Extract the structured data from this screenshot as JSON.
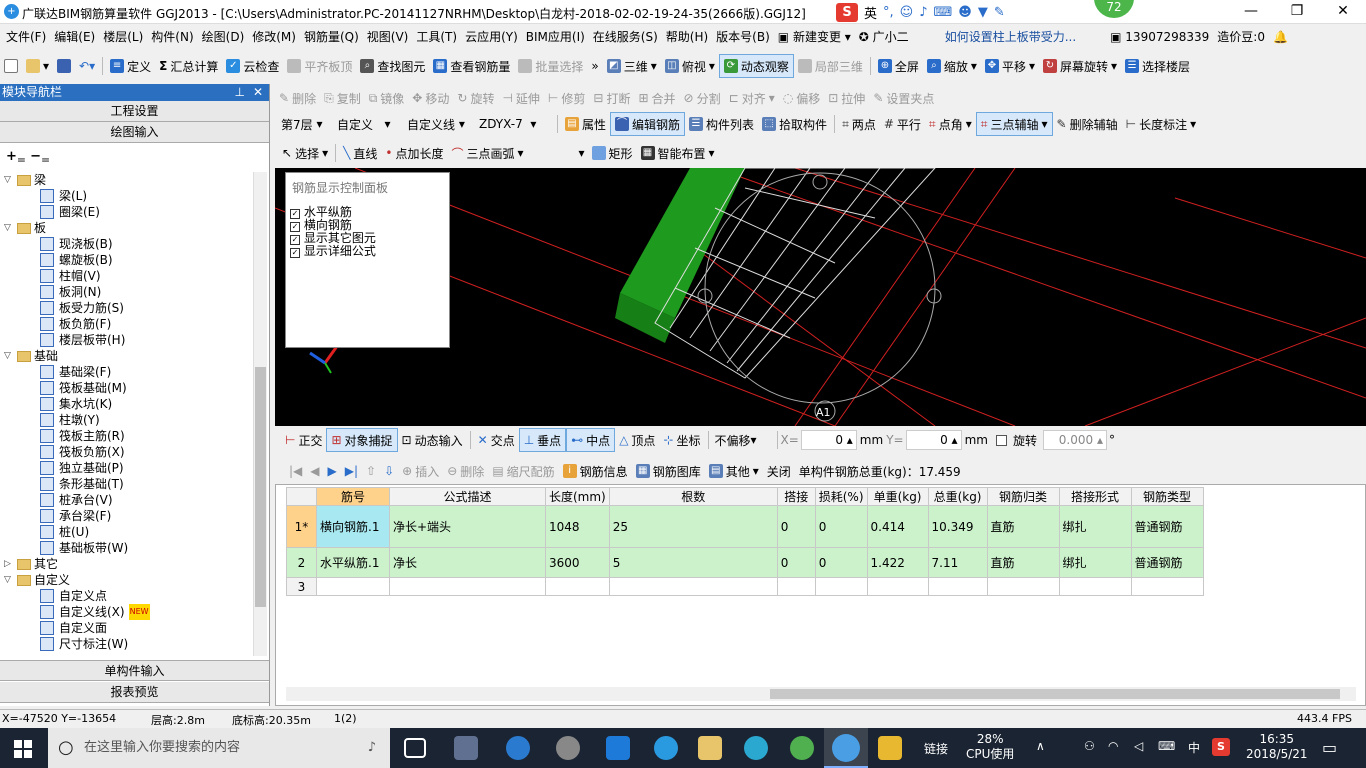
{
  "window": {
    "title": "广联达BIM钢筋算量软件 GGJ2013 - [C:\\Users\\Administrator.PC-20141127NRHM\\Desktop\\白龙村-2018-02-02-19-24-35(2666版).GGJ12]",
    "badge": "72",
    "ime_lang": "英"
  },
  "menu": [
    "文件(F)",
    "编辑(E)",
    "楼层(L)",
    "构件(N)",
    "绘图(D)",
    "修改(M)",
    "钢筋量(Q)",
    "视图(V)",
    "工具(T)",
    "云应用(Y)",
    "BIM应用(I)",
    "在线服务(S)",
    "帮助(H)",
    "版本号(B)",
    "新建变更",
    "广小二",
    "如何设置柱上板带受力...",
    "13907298339",
    "造价豆:0"
  ],
  "toolbar1": [
    "定义",
    "汇总计算",
    "云检查",
    "平齐板顶",
    "查找图元",
    "查看钢筋量",
    "批量选择",
    "三维",
    "俯视",
    "动态观察",
    "局部三维",
    "全屏",
    "缩放",
    "平移",
    "屏幕旋转",
    "选择楼层"
  ],
  "toolbar2": [
    "删除",
    "复制",
    "镜像",
    "移动",
    "旋转",
    "延伸",
    "修剪",
    "打断",
    "合并",
    "分割",
    "对齐",
    "偏移",
    "拉伸",
    "设置夹点"
  ],
  "toolbar3": {
    "floor": "第7层",
    "type1": "自定义",
    "type2": "自定义线",
    "name": "ZDYX-7",
    "items": [
      "属性",
      "编辑钢筋",
      "构件列表",
      "拾取构件",
      "两点",
      "平行",
      "点角",
      "三点辅轴",
      "删除辅轴",
      "长度标注"
    ]
  },
  "toolbar4": [
    "选择",
    "直线",
    "点加长度",
    "三点画弧",
    "矩形",
    "智能布置"
  ],
  "left_panel": {
    "title": "模块导航栏",
    "btn_project": "工程设置",
    "btn_draw": "绘图输入",
    "btn_single": "单构件输入",
    "btn_report": "报表预览",
    "tree": [
      {
        "type": "folder",
        "label": "梁",
        "lv": 0
      },
      {
        "type": "leaf",
        "label": "梁(L)",
        "lv": 1
      },
      {
        "type": "leaf",
        "label": "圈梁(E)",
        "lv": 1
      },
      {
        "type": "folder",
        "label": "板",
        "lv": 0
      },
      {
        "type": "leaf",
        "label": "现浇板(B)",
        "lv": 1
      },
      {
        "type": "leaf",
        "label": "螺旋板(B)",
        "lv": 1
      },
      {
        "type": "leaf",
        "label": "柱帽(V)",
        "lv": 1
      },
      {
        "type": "leaf",
        "label": "板洞(N)",
        "lv": 1
      },
      {
        "type": "leaf",
        "label": "板受力筋(S)",
        "lv": 1
      },
      {
        "type": "leaf",
        "label": "板负筋(F)",
        "lv": 1
      },
      {
        "type": "leaf",
        "label": "楼层板带(H)",
        "lv": 1
      },
      {
        "type": "folder",
        "label": "基础",
        "lv": 0
      },
      {
        "type": "leaf",
        "label": "基础梁(F)",
        "lv": 1
      },
      {
        "type": "leaf",
        "label": "筏板基础(M)",
        "lv": 1
      },
      {
        "type": "leaf",
        "label": "集水坑(K)",
        "lv": 1
      },
      {
        "type": "leaf",
        "label": "柱墩(Y)",
        "lv": 1
      },
      {
        "type": "leaf",
        "label": "筏板主筋(R)",
        "lv": 1
      },
      {
        "type": "leaf",
        "label": "筏板负筋(X)",
        "lv": 1
      },
      {
        "type": "leaf",
        "label": "独立基础(P)",
        "lv": 1
      },
      {
        "type": "leaf",
        "label": "条形基础(T)",
        "lv": 1
      },
      {
        "type": "leaf",
        "label": "桩承台(V)",
        "lv": 1
      },
      {
        "type": "leaf",
        "label": "承台梁(F)",
        "lv": 1
      },
      {
        "type": "leaf",
        "label": "桩(U)",
        "lv": 1
      },
      {
        "type": "leaf",
        "label": "基础板带(W)",
        "lv": 1
      },
      {
        "type": "folder-closed",
        "label": "其它",
        "lv": 0
      },
      {
        "type": "folder",
        "label": "自定义",
        "lv": 0
      },
      {
        "type": "leaf",
        "label": "自定义点",
        "lv": 1
      },
      {
        "type": "leaf",
        "label": "自定义线(X)",
        "lv": 1,
        "new": "NEW"
      },
      {
        "type": "leaf",
        "label": "自定义面",
        "lv": 1
      },
      {
        "type": "leaf",
        "label": "尺寸标注(W)",
        "lv": 1
      }
    ]
  },
  "rebar_panel": {
    "title": "钢筋显示控制面板",
    "options": [
      "水平纵筋",
      "横向钢筋",
      "显示其它图元",
      "显示详细公式"
    ]
  },
  "canvas": {
    "axis_label": "A1"
  },
  "snap": {
    "items": [
      "正交",
      "对象捕捉",
      "动态输入",
      "交点",
      "垂点",
      "中点",
      "顶点",
      "坐标"
    ],
    "offset": "不偏移",
    "x_label": "X=",
    "x": "0",
    "y_label": "Y=",
    "y": "0",
    "unit": "mm",
    "rotate_label": "旋转",
    "rotate": "0.000",
    "deg": "°"
  },
  "grid_toolbar": {
    "items": [
      "插入",
      "删除",
      "缩尺配筋",
      "钢筋信息",
      "钢筋图库",
      "其他",
      "关闭"
    ],
    "total": "单构件钢筋总重(kg)：17.459"
  },
  "grid": {
    "headers": [
      "筋号",
      "公式描述",
      "长度(mm)",
      "根数",
      "搭接",
      "损耗(%)",
      "单重(kg)",
      "总重(kg)",
      "钢筋归类",
      "搭接形式",
      "钢筋类型"
    ],
    "rows": [
      {
        "rn": "1*",
        "cells": [
          "横向钢筋.1",
          "净长+端头",
          "1048",
          "25",
          "0",
          "0",
          "0.414",
          "10.349",
          "直筋",
          "绑扎",
          "普通钢筋"
        ]
      },
      {
        "rn": "2",
        "cells": [
          "水平纵筋.1",
          "净长",
          "3600",
          "5",
          "0",
          "0",
          "1.422",
          "7.11",
          "直筋",
          "绑扎",
          "普通钢筋"
        ]
      },
      {
        "rn": "3",
        "cells": [
          "",
          "",
          "",
          "",
          "",
          "",
          "",
          "",
          "",
          "",
          ""
        ]
      }
    ]
  },
  "status": {
    "coord": "X=-47520 Y=-13654",
    "floor_h": "层高:2.8m",
    "base_h": "底标高:20.35m",
    "count": "1(2)",
    "fps": "443.4 FPS"
  },
  "taskbar": {
    "search": "在这里输入你要搜索的内容",
    "link": "链接",
    "cpu": "28%",
    "cpu_label": "CPU使用",
    "lang": "中",
    "time": "16:35",
    "date": "2018/5/21"
  }
}
